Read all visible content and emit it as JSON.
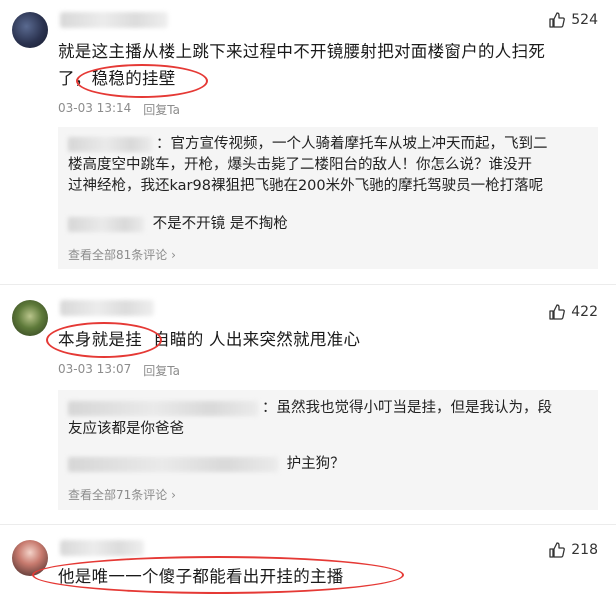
{
  "comments": [
    {
      "likes": "524",
      "text_line1": "就是这主播从楼上跳下来过程中不开镜腰射把对面楼窗户的人扫死",
      "text_line2_pre": "了，",
      "text_line2_hl": "稳稳的挂壁",
      "time": "03-03 13:14",
      "reply_label": "回复Ta",
      "replies": [
        {
          "line1": "：官方宣传视频，一个人骑着摩托车从坡上冲天而起，飞到二",
          "line2": "楼高度空中跳车，开枪，爆头击毙了二楼阳台的敌人！你怎么说？谁没开",
          "line3": "过神经枪，我还kar98裸狙把飞驰在200米外飞驰的摩托驾驶员一枪打落呢"
        },
        {
          "line1": "不是不开镜 是不掏枪"
        }
      ],
      "view_all": "查看全部81条评论 ›"
    },
    {
      "likes": "422",
      "text_hl": "本身就是挂",
      "text_rest": "自瞄的  人出来突然就甩准心",
      "time": "03-03 13:07",
      "reply_label": "回复Ta",
      "replies": [
        {
          "line1": "：虽然我也觉得小叮当是挂，但是我认为，段",
          "line2": "友应该都是你爸爸"
        },
        {
          "line1": "护主狗？"
        }
      ],
      "view_all": "查看全部71条评论 ›"
    },
    {
      "likes": "218",
      "text": "他是唯一一个傻子都能看出开挂的主播"
    }
  ],
  "colors": {
    "highlight": "#e53935",
    "meta": "#8c8c8c",
    "reply_bg": "#f5f5f5"
  },
  "icons": {
    "like": "thumbs-up-icon",
    "chevron": "chevron-right-icon"
  }
}
